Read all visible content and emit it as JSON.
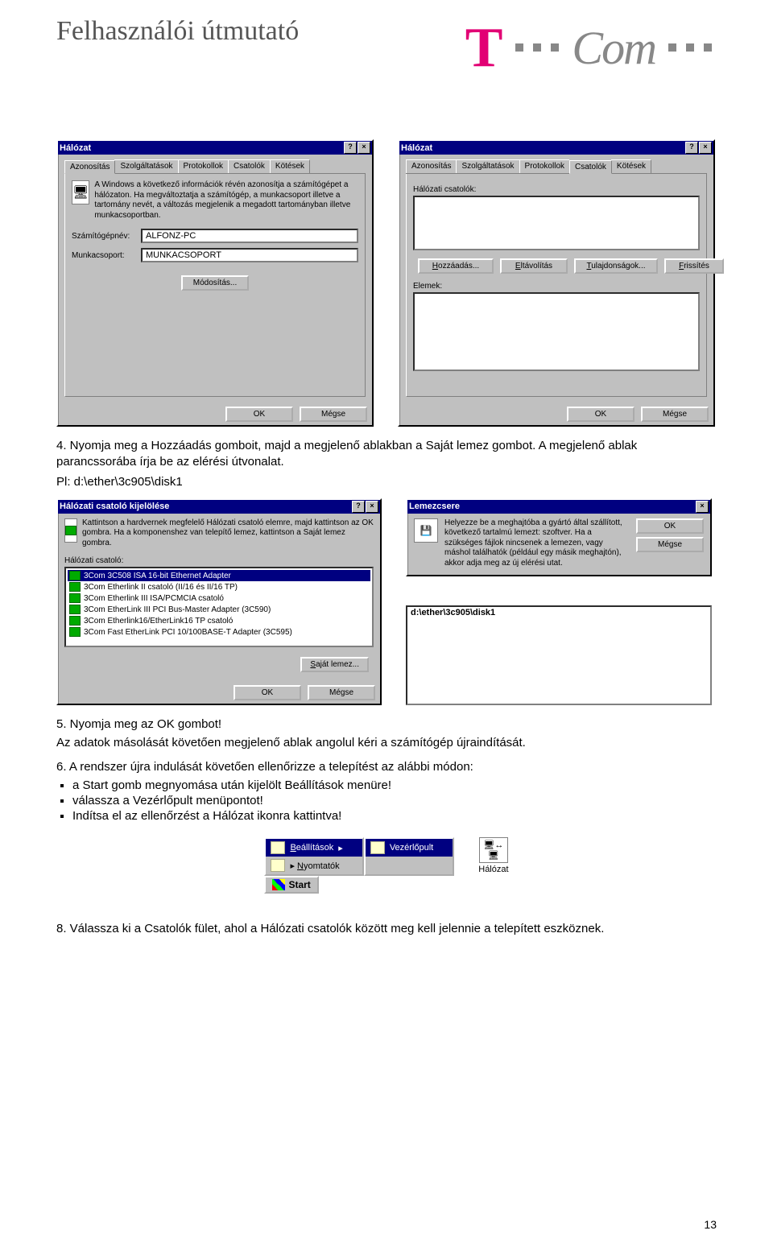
{
  "doc": {
    "title": "Felhasználói útmutató",
    "logo_t": "T",
    "logo_com": "Com",
    "page_number": "13"
  },
  "text4": "4. Nyomja meg a Hozzáadás gomboit, majd a megjelenő ablakban a Saját lemez gombot. A megjelenő ablak parancssorába írja be az elérési útvonalat.",
  "text4b": "Pl: d:\\ether\\3c905\\disk1",
  "text5": "5. Nyomja meg az OK gombot!",
  "text5b": "Az adatok másolását követően megjelenő ablak angolul kéri a számítógép újraindítását.",
  "text6": "6. A rendszer újra indulását követően ellenőrizze a telepítést az alábbi módon:",
  "bullets": [
    "a Start gomb megnyomása után kijelölt Beállítások menüre!",
    "válassza a Vezérlőpult menüpontot!",
    "Indítsa el az ellenőrzést a Hálózat ikonra kattintva!"
  ],
  "text8": "8. Válassza ki a Csatolók fület, ahol a Hálózati csatolók között meg kell jelennie a telepített eszköznek.",
  "winA": {
    "title": "Hálózat",
    "tabs": [
      "Azonosítás",
      "Szolgáltatások",
      "Protokollok",
      "Csatolók",
      "Kötések"
    ],
    "active_tab": 0,
    "info": "A Windows a következő információk révén azonosítja a számítógépet a hálózaton. Ha megváltoztatja a számítógép, a munkacsoport illetve a tartomány nevét, a változás megjelenik a megadott tartományban illetve munkacsoportban.",
    "label_pc": "Számítógépnév:",
    "val_pc": "ALFONZ-PC",
    "label_wg": "Munkacsoport:",
    "val_wg": "MUNKACSOPORT",
    "btn_mod": "Módosítás...",
    "btn_ok": "OK",
    "btn_cancel": "Mégse"
  },
  "winB": {
    "title": "Hálózat",
    "tabs": [
      "Azonosítás",
      "Szolgáltatások",
      "Protokollok",
      "Csatolók",
      "Kötések"
    ],
    "active_tab": 3,
    "label_list": "Hálózati csatolók:",
    "btn_add": "Hozzáadás...",
    "btn_del": "Eltávolítás",
    "btn_prop": "Tulajdonságok...",
    "btn_refresh": "Frissítés",
    "label_notes": "Elemek:",
    "btn_ok": "OK",
    "btn_cancel": "Mégse"
  },
  "winC": {
    "title": "Hálózati csatoló kijelölése",
    "info": "Kattintson a hardvernek megfelelő Hálózati csatoló elemre, majd kattintson az OK gombra. Ha a komponenshez van telepítő lemez, kattintson a Saját lemez gombra.",
    "label_list": "Hálózati csatoló:",
    "items": [
      "3Com 3C508 ISA 16-bit Ethernet Adapter",
      "3Com Etherlink II csatoló (II/16 és II/16 TP)",
      "3Com Etherlink III ISA/PCMCIA csatoló",
      "3Com EtherLink III PCI Bus-Master Adapter (3C590)",
      "3Com Etherlink16/EtherLink16 TP csatoló",
      "3Com Fast EtherLink PCI 10/100BASE-T Adapter (3C595)"
    ],
    "btn_disk": "Saját lemez...",
    "btn_ok": "OK",
    "btn_cancel": "Mégse"
  },
  "winD": {
    "title": "Lemezcsere",
    "info": "Helyezze be a meghajtóba a gyártó által szállított, következő tartalmú lemezt: szoftver. Ha a szükséges fájlok nincsenek a lemezen, vagy máshol találhatók (például egy másik meghajtón), akkor adja meg az új elérési utat.",
    "val_path": "d:\\ether\\3c905\\disk1",
    "btn_ok": "OK",
    "btn_cancel": "Mégse"
  },
  "startfig": {
    "start": "Start",
    "settings_label": "Beállítások",
    "printers_label": "Nyomtatók",
    "cp_label": "Vezérlőpult",
    "net_label": "Hálózat"
  }
}
